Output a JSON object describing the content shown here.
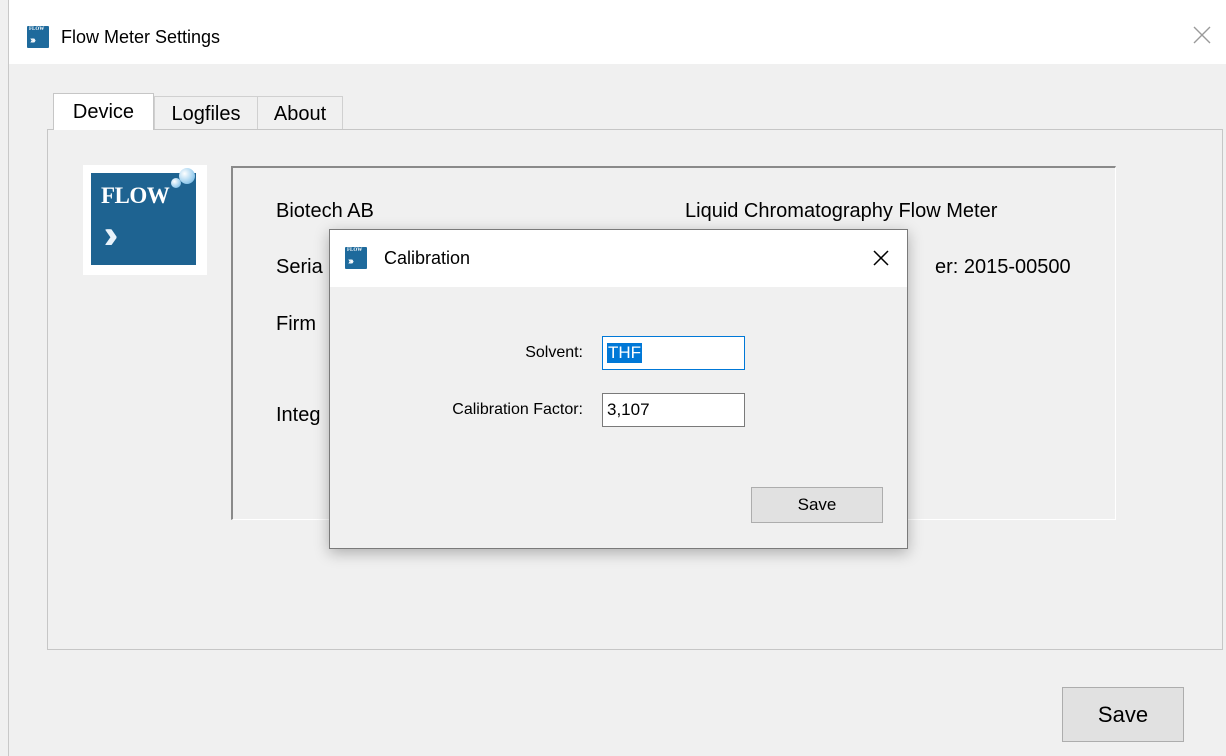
{
  "window": {
    "title": "Flow Meter Settings",
    "icon": "flow-app-icon",
    "save_label": "Save"
  },
  "tabs": [
    {
      "label": "Device",
      "selected": true
    },
    {
      "label": "Logfiles",
      "selected": false
    },
    {
      "label": "About",
      "selected": false
    }
  ],
  "device": {
    "logo": {
      "text": "FLOW",
      "chevrons": "›››",
      "icon": "flow-logo-icon"
    },
    "company": "Biotech AB",
    "product": "Liquid Chromatography Flow Meter",
    "serial_partial": "Seria",
    "serial_value_partial": "er: 2015-00500",
    "firmware_partial": "Firm",
    "integ_partial": "Integ"
  },
  "dialog": {
    "title": "Calibration",
    "solvent_label": "Solvent:",
    "solvent_value": "THF",
    "factor_label": "Calibration Factor:",
    "factor_value": "3,107",
    "save_label": "Save"
  },
  "colors": {
    "accent": "#0078d7",
    "logo_blue": "#1e6391",
    "button_bg": "#e1e1e1"
  }
}
